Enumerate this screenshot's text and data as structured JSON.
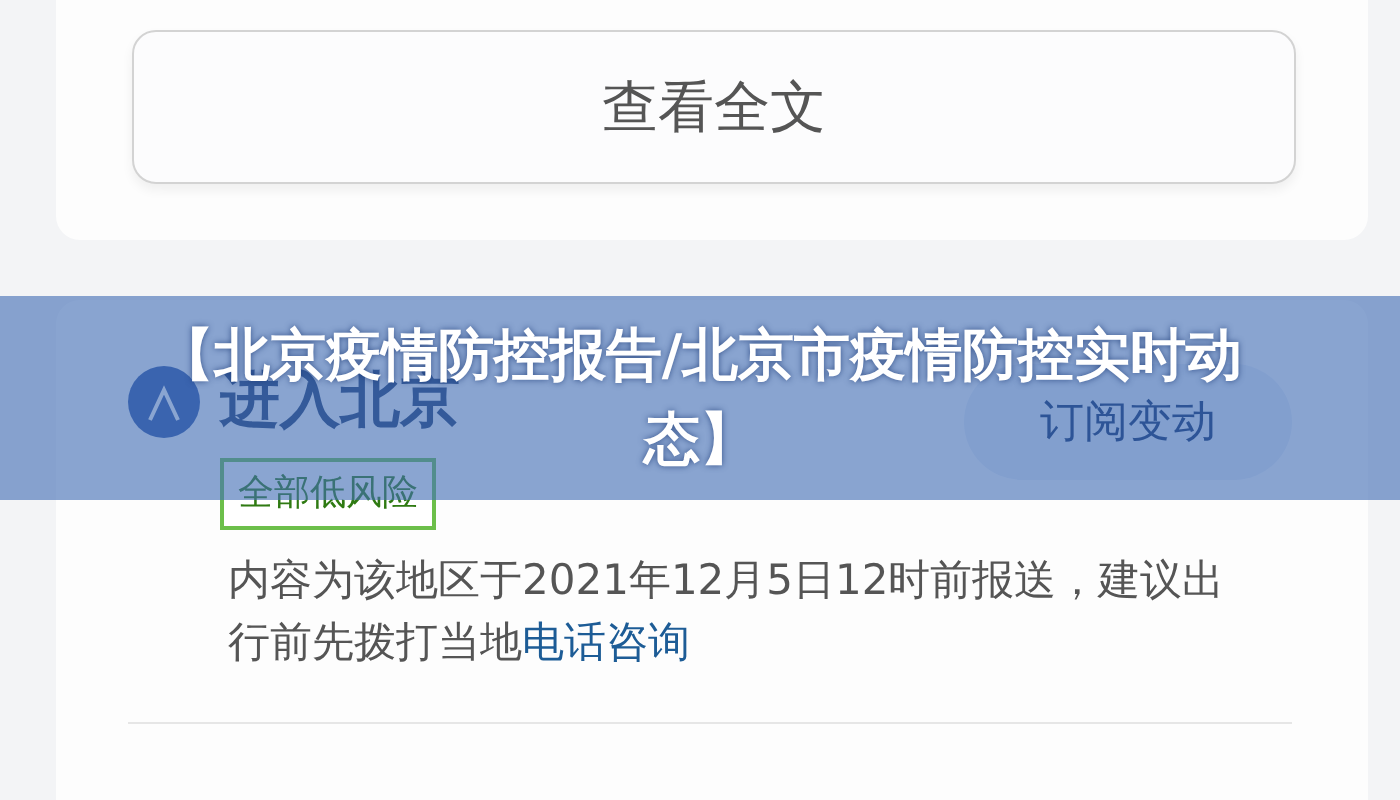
{
  "top_card": {
    "button": "查看全文"
  },
  "region_card": {
    "title": "进入北京",
    "risk_badge": "全部低风险",
    "subscribe_button": "订阅变动",
    "notice": "内容为该地区于2021年12月5日12时前报送，建议出行前先拨打当地",
    "notice_link": "电话咨询"
  },
  "banner": {
    "title": "【北京疫情防控报告/北京市疫情防控实时动态】"
  }
}
